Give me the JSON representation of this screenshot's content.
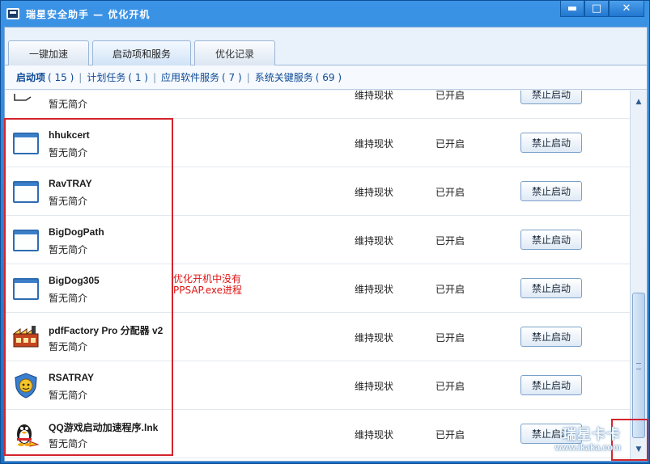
{
  "window": {
    "title": "瑞星安全助手 — 优化开机",
    "controls": {
      "minimize": "▬",
      "maximize": "□",
      "close": "✕"
    }
  },
  "tabs": [
    {
      "label": "一键加速",
      "active": false
    },
    {
      "label": "启动项和服务",
      "active": true
    },
    {
      "label": "优化记录",
      "active": false
    }
  ],
  "subnav": [
    {
      "label": "启动项",
      "count": "( 15 )",
      "active": true
    },
    {
      "label": "计划任务",
      "count": "( 1 )",
      "active": false
    },
    {
      "label": "应用软件服务",
      "count": "( 7 )",
      "active": false
    },
    {
      "label": "系统关键服务",
      "count": "( 69 )",
      "active": false
    }
  ],
  "list": {
    "rows": [
      {
        "name": "",
        "desc": "暂无简介",
        "suggest": "维持现状",
        "status": "已开启",
        "action": "禁止启动",
        "icon": "window-icon"
      },
      {
        "name": "hhukcert",
        "desc": "暂无简介",
        "suggest": "维持现状",
        "status": "已开启",
        "action": "禁止启动",
        "icon": "window-icon"
      },
      {
        "name": "RavTRAY",
        "desc": "暂无简介",
        "suggest": "维持现状",
        "status": "已开启",
        "action": "禁止启动",
        "icon": "window-icon"
      },
      {
        "name": "BigDogPath",
        "desc": "暂无简介",
        "suggest": "维持现状",
        "status": "已开启",
        "action": "禁止启动",
        "icon": "window-icon"
      },
      {
        "name": "BigDog305",
        "desc": "暂无简介",
        "suggest": "维持现状",
        "status": "已开启",
        "action": "禁止启动",
        "icon": "window-icon"
      },
      {
        "name": "pdfFactory Pro 分配器 v2",
        "desc": "暂无简介",
        "suggest": "维持现状",
        "status": "已开启",
        "action": "禁止启动",
        "icon": "factory-icon"
      },
      {
        "name": "RSATRAY",
        "desc": "暂无简介",
        "suggest": "维持现状",
        "status": "已开启",
        "action": "禁止启动",
        "icon": "rising-shield-icon"
      },
      {
        "name": "QQ游戏启动加速程序.lnk",
        "desc": "暂无简介",
        "suggest": "维持现状",
        "status": "已开启",
        "action": "禁止启动",
        "icon": "qq-penguin-icon"
      }
    ]
  },
  "annotation": {
    "line1": "优化开机中没有",
    "line2": "PPSAP.exe进程"
  },
  "watermark": {
    "line1": "瑞星卡卡",
    "line2": "www.ikaka.com"
  },
  "colors": {
    "annotation": "#e01414",
    "titlebar": "#2a7fd0",
    "link": "#0d4a96"
  }
}
